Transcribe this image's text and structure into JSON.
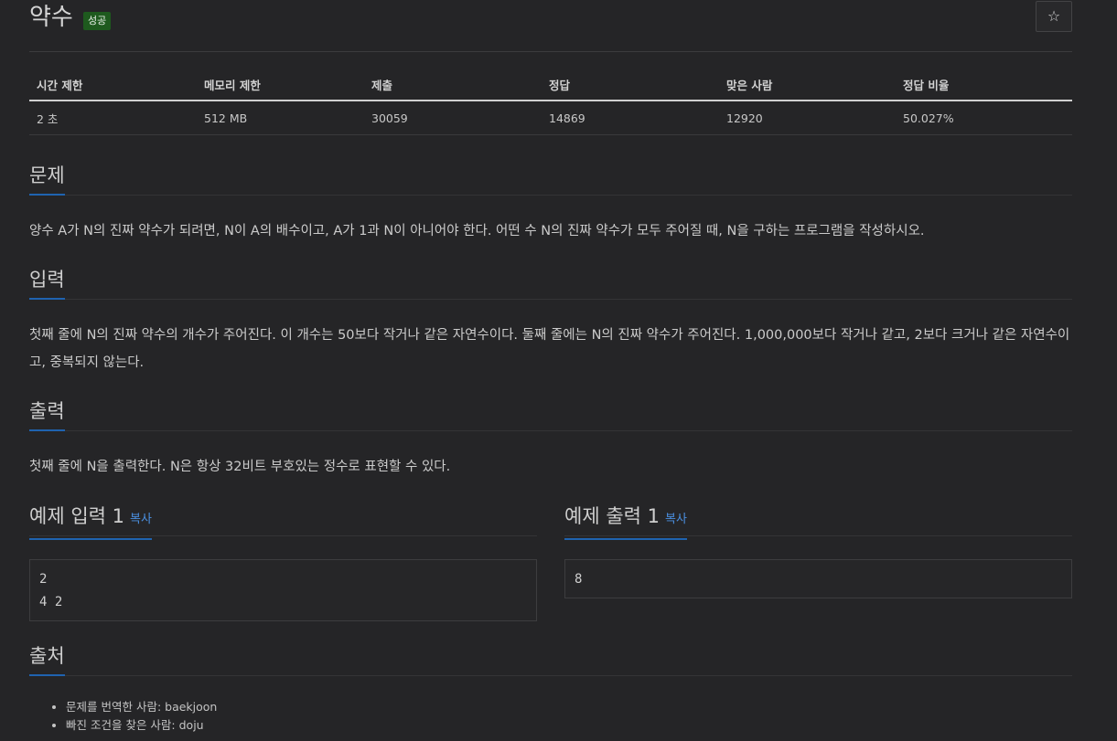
{
  "problem": {
    "title": "약수",
    "badge": "성공",
    "star_icon": "☆"
  },
  "info_table": {
    "headers": [
      "시간 제한",
      "메모리 제한",
      "제출",
      "정답",
      "맞은 사람",
      "정답 비율"
    ],
    "row": [
      "2 초",
      "512 MB",
      "30059",
      "14869",
      "12920",
      "50.027%"
    ]
  },
  "sections": {
    "problem": {
      "heading": "문제",
      "text": "양수 A가 N의 진짜 약수가 되려면, N이 A의 배수이고, A가 1과 N이 아니어야 한다. 어떤 수 N의 진짜 약수가 모두 주어질 때, N을 구하는 프로그램을 작성하시오."
    },
    "input": {
      "heading": "입력",
      "text": "첫째 줄에 N의 진짜 약수의 개수가 주어진다. 이 개수는 50보다 작거나 같은 자연수이다. 둘째 줄에는 N의 진짜 약수가 주어진다. 1,000,000보다 작거나 같고, 2보다 크거나 같은 자연수이고, 중복되지 않는다."
    },
    "output": {
      "heading": "출력",
      "text": "첫째 줄에 N을 출력한다. N은 항상 32비트 부호있는 정수로 표현할 수 있다."
    }
  },
  "samples": {
    "input": {
      "heading": "예제 입력 1",
      "copy_label": "복사",
      "content": "2\n4 2"
    },
    "output": {
      "heading": "예제 출력 1",
      "copy_label": "복사",
      "content": "8"
    }
  },
  "source": {
    "heading": "출처",
    "items": [
      "문제를 번역한 사람: baekjoon",
      "빠진 조건을 찾은 사람: doju"
    ]
  }
}
